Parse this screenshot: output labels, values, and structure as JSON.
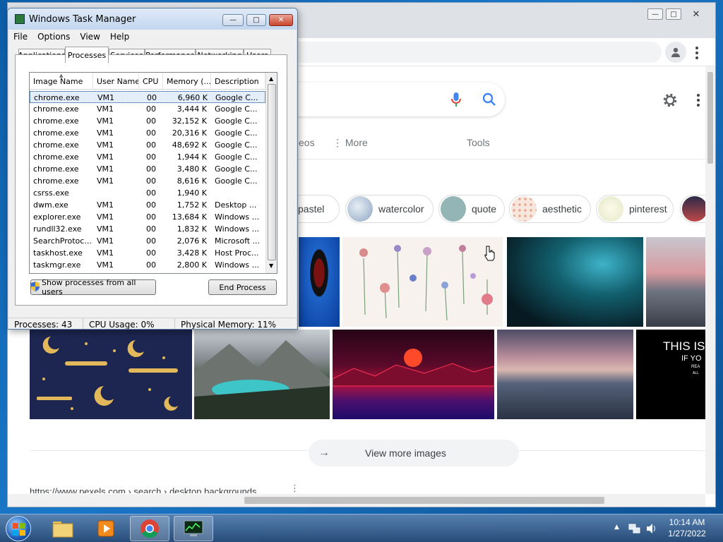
{
  "chrome": {
    "search_tabs": [
      "eos",
      "More",
      "Tools"
    ],
    "chips": [
      {
        "label": "pastel",
        "color": "#c9b8d6"
      },
      {
        "label": "watercolor",
        "color": "#a8b8cc"
      },
      {
        "label": "quote",
        "color": "#8fb1b1"
      },
      {
        "label": "aesthetic",
        "color": "#f0d7c7"
      },
      {
        "label": "pinterest",
        "color": "#eef0dc"
      }
    ],
    "tile_overlay": {
      "line1": "THIS IS",
      "line2": "IF YO",
      "line3": "REA",
      "line4": "ALL"
    },
    "view_more": "View more images",
    "cut_url": "https://www.pexels.com › search › desktop backgrounds"
  },
  "taskmanager": {
    "title": "Windows Task Manager",
    "menu": [
      "File",
      "Options",
      "View",
      "Help"
    ],
    "tabs": [
      {
        "label": "Applications",
        "active": false
      },
      {
        "label": "Processes",
        "active": true
      },
      {
        "label": "Services",
        "active": false
      },
      {
        "label": "Performance",
        "active": false
      },
      {
        "label": "Networking",
        "active": false
      },
      {
        "label": "Users",
        "active": false
      }
    ],
    "columns": [
      "Image Name",
      "User Name",
      "CPU",
      "Memory (...",
      "Description"
    ],
    "processes": [
      {
        "name": "chrome.exe",
        "user": "VM1",
        "cpu": "00",
        "mem": "6,960 K",
        "desc": "Google C...",
        "selected": true
      },
      {
        "name": "chrome.exe",
        "user": "VM1",
        "cpu": "00",
        "mem": "3,444 K",
        "desc": "Google C..."
      },
      {
        "name": "chrome.exe",
        "user": "VM1",
        "cpu": "00",
        "mem": "32,152 K",
        "desc": "Google C..."
      },
      {
        "name": "chrome.exe",
        "user": "VM1",
        "cpu": "00",
        "mem": "20,316 K",
        "desc": "Google C..."
      },
      {
        "name": "chrome.exe",
        "user": "VM1",
        "cpu": "00",
        "mem": "48,692 K",
        "desc": "Google C..."
      },
      {
        "name": "chrome.exe",
        "user": "VM1",
        "cpu": "00",
        "mem": "1,944 K",
        "desc": "Google C..."
      },
      {
        "name": "chrome.exe",
        "user": "VM1",
        "cpu": "00",
        "mem": "3,480 K",
        "desc": "Google C..."
      },
      {
        "name": "chrome.exe",
        "user": "VM1",
        "cpu": "00",
        "mem": "8,616 K",
        "desc": "Google C..."
      },
      {
        "name": "csrss.exe",
        "user": "",
        "cpu": "00",
        "mem": "1,940 K",
        "desc": ""
      },
      {
        "name": "dwm.exe",
        "user": "VM1",
        "cpu": "00",
        "mem": "1,752 K",
        "desc": "Desktop ..."
      },
      {
        "name": "explorer.exe",
        "user": "VM1",
        "cpu": "00",
        "mem": "13,684 K",
        "desc": "Windows ..."
      },
      {
        "name": "rundll32.exe",
        "user": "VM1",
        "cpu": "00",
        "mem": "1,832 K",
        "desc": "Windows ..."
      },
      {
        "name": "SearchProtoc...",
        "user": "VM1",
        "cpu": "00",
        "mem": "2,076 K",
        "desc": "Microsoft ..."
      },
      {
        "name": "taskhost.exe",
        "user": "VM1",
        "cpu": "00",
        "mem": "3,428 K",
        "desc": "Host Proc..."
      },
      {
        "name": "taskmgr.exe",
        "user": "VM1",
        "cpu": "00",
        "mem": "2,800 K",
        "desc": "Windows ..."
      }
    ],
    "show_all_label": "Show processes from all users",
    "end_process_label": "End Process",
    "status": {
      "processes": "Processes: 43",
      "cpu": "CPU Usage: 0%",
      "memory": "Physical Memory: 11%"
    }
  },
  "taskbar": {
    "time": "10:14 AM",
    "date": "1/27/2022"
  }
}
